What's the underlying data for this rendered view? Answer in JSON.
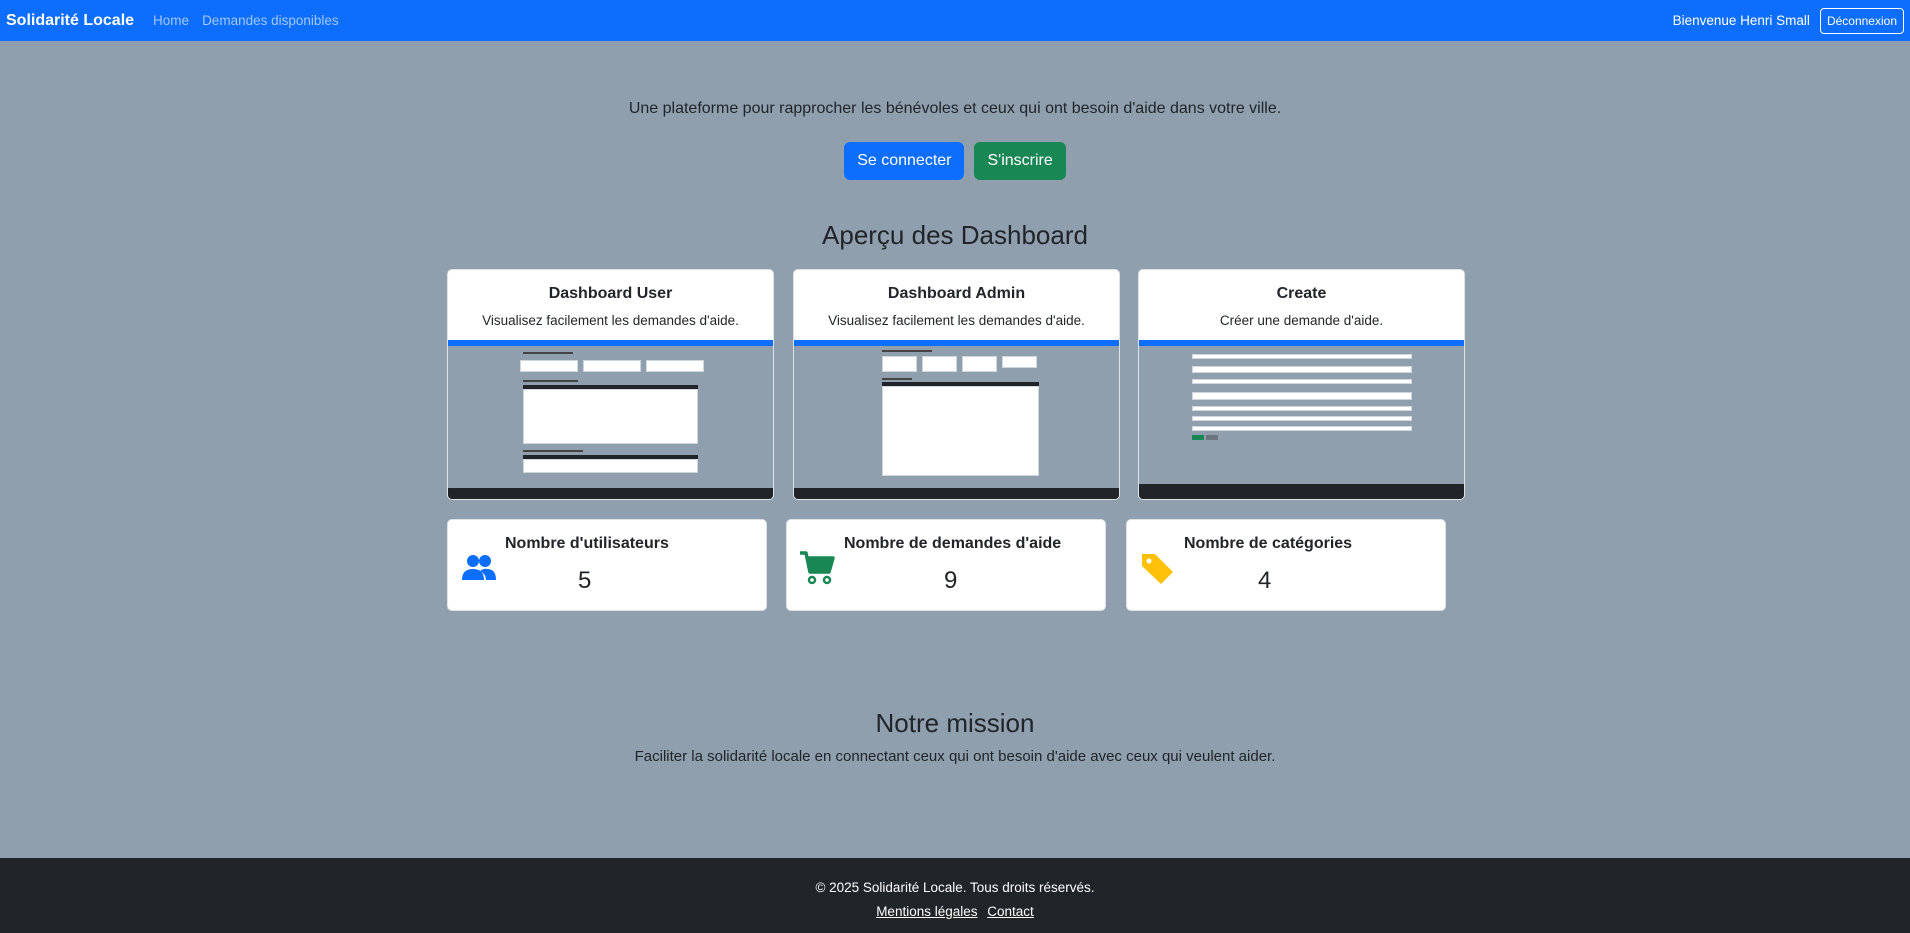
{
  "nav": {
    "brand": "Solidarité Locale",
    "links": [
      "Home",
      "Demandes disponibles"
    ],
    "welcome": "Bienvenue Henri Small",
    "logout": "Déconnexion"
  },
  "hero": {
    "tagline": "Une plateforme pour rapprocher les bénévoles et ceux qui ont besoin d'aide dans votre ville.",
    "login_button": "Se connecter",
    "signup_button": "S'inscrire"
  },
  "dashboards": {
    "title": "Aperçu des Dashboard",
    "cards": [
      {
        "title": "Dashboard User",
        "description": "Visualisez facilement les demandes d'aide."
      },
      {
        "title": "Dashboard Admin",
        "description": "Visualisez facilement les demandes d'aide."
      },
      {
        "title": "Create",
        "description": "Créer une demande d'aide."
      }
    ]
  },
  "stats": [
    {
      "label": "Nombre d'utilisateurs",
      "value": "5",
      "icon": "users-icon",
      "color": "#0d6efd"
    },
    {
      "label": "Nombre de demandes d'aide",
      "value": "9",
      "icon": "cart-icon",
      "color": "#198754"
    },
    {
      "label": "Nombre de catégories",
      "value": "4",
      "icon": "tags-icon",
      "color": "#ffc107"
    }
  ],
  "mission": {
    "title": "Notre mission",
    "text": "Faciliter la solidarité locale en connectant ceux qui ont besoin d'aide avec ceux qui veulent aider."
  },
  "footer": {
    "copyright": "© 2025 Solidarité Locale. Tous droits réservés.",
    "links": [
      "Mentions légales",
      "Contact"
    ]
  }
}
